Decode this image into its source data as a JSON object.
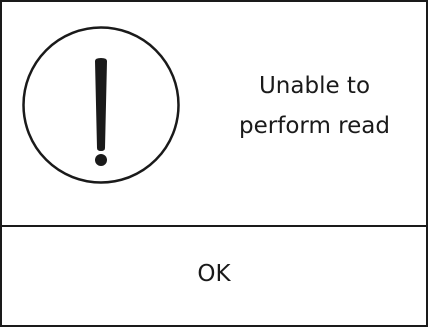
{
  "dialog": {
    "icon": "exclamation-icon",
    "message_lines": [
      "Unable to",
      "perform read"
    ],
    "ok_label": "OK"
  },
  "colors": {
    "foreground": "#1a1a1a",
    "background": "#ffffff"
  }
}
